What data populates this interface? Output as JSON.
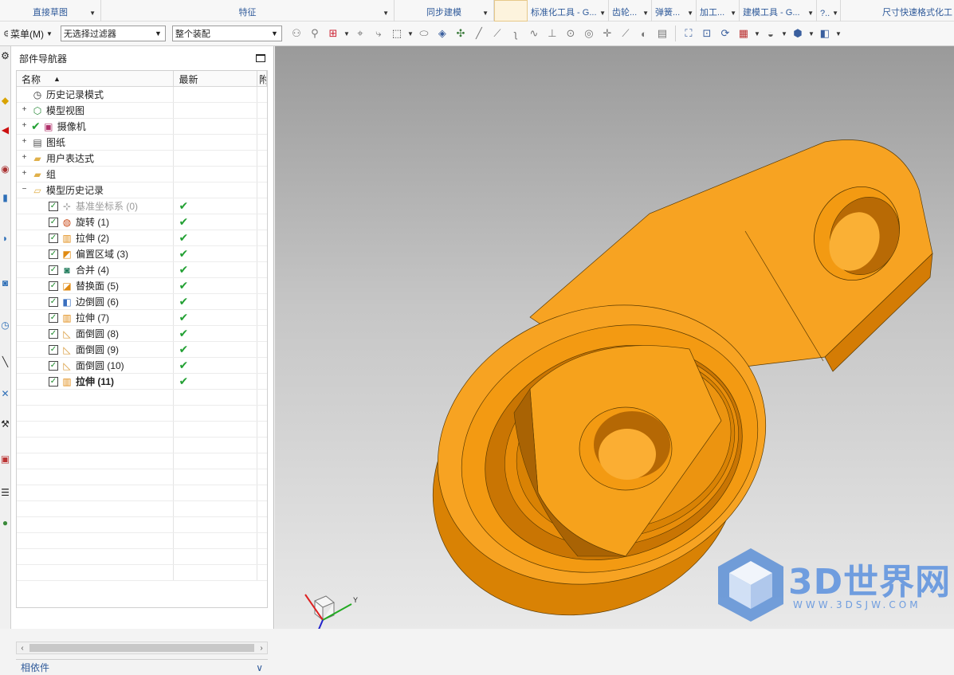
{
  "ribbon": {
    "groups": [
      {
        "label": "直接草图",
        "has_dropdown": true
      },
      {
        "label": "特征",
        "has_dropdown": true
      },
      {
        "label": "同步建模",
        "has_dropdown": true
      },
      {
        "label": ""
      },
      {
        "label": "标准化工具 - G...",
        "has_dropdown": true
      },
      {
        "label": "齿轮...",
        "has_dropdown": true
      },
      {
        "label": "弹簧...",
        "has_dropdown": true
      },
      {
        "label": "加工...",
        "has_dropdown": true
      },
      {
        "label": "建模工具 - G...",
        "has_dropdown": true
      },
      {
        "label": "?..",
        "has_dropdown": true
      },
      {
        "label": "尺寸快速格式化工"
      }
    ]
  },
  "toolbar": {
    "menu_label": "菜单(M)",
    "filter_value": "无选择过滤器",
    "assembly_value": "整个装配",
    "icons": [
      "snap-icon",
      "snap-point-icon",
      "select-icon",
      "selection-box-icon",
      "render-style-icon",
      "view-orient-icon",
      "point-icon",
      "line-icon",
      "curve-icon",
      "circle-icon",
      "rotate-icon",
      "layer-icon"
    ]
  },
  "navigator": {
    "title": "部件导航器",
    "columns": [
      "名称",
      "最新",
      "附"
    ],
    "rows": [
      {
        "label": "历史记录模式",
        "indent": 1,
        "expander": "",
        "checkbox": false,
        "icon": "clock-icon",
        "latest": ""
      },
      {
        "label": "模型视图",
        "indent": 1,
        "expander": "+",
        "checkbox": false,
        "icon": "model-view-icon",
        "latest": ""
      },
      {
        "label": "摄像机",
        "indent": 1,
        "expander": "+",
        "checkbox": false,
        "check_mark": "✔",
        "icon": "camera-icon",
        "latest": ""
      },
      {
        "label": "图纸",
        "indent": 1,
        "expander": "+",
        "checkbox": false,
        "icon": "drawing-icon",
        "latest": ""
      },
      {
        "label": "用户表达式",
        "indent": 1,
        "expander": "+",
        "checkbox": false,
        "icon": "folder-icon",
        "latest": ""
      },
      {
        "label": "组",
        "indent": 1,
        "expander": "+",
        "checkbox": false,
        "icon": "folder-icon",
        "latest": ""
      },
      {
        "label": "模型历史记录",
        "indent": 1,
        "expander": "−",
        "checkbox": false,
        "icon": "folder-open-icon",
        "latest": ""
      },
      {
        "label": "基准坐标系 (0)",
        "indent": 2,
        "checkbox": true,
        "icon": "datum-csys-icon",
        "latest": "✔",
        "style": "gray"
      },
      {
        "label": "旋转 (1)",
        "indent": 2,
        "checkbox": true,
        "icon": "revolve-icon",
        "latest": "✔"
      },
      {
        "label": "拉伸 (2)",
        "indent": 2,
        "checkbox": true,
        "icon": "extrude-icon",
        "latest": "✔"
      },
      {
        "label": "偏置区域 (3)",
        "indent": 2,
        "checkbox": true,
        "icon": "offset-region-icon",
        "latest": "✔"
      },
      {
        "label": "合并 (4)",
        "indent": 2,
        "checkbox": true,
        "icon": "unite-icon",
        "latest": "✔"
      },
      {
        "label": "替换面 (5)",
        "indent": 2,
        "checkbox": true,
        "icon": "replace-face-icon",
        "latest": "✔"
      },
      {
        "label": "边倒圆 (6)",
        "indent": 2,
        "checkbox": true,
        "icon": "edge-blend-icon",
        "latest": "✔"
      },
      {
        "label": "拉伸 (7)",
        "indent": 2,
        "checkbox": true,
        "icon": "extrude-icon",
        "latest": "✔"
      },
      {
        "label": "面倒圆 (8)",
        "indent": 2,
        "checkbox": true,
        "icon": "face-blend-icon",
        "latest": "✔"
      },
      {
        "label": "面倒圆 (9)",
        "indent": 2,
        "checkbox": true,
        "icon": "face-blend-icon",
        "latest": "✔"
      },
      {
        "label": "面倒圆 (10)",
        "indent": 2,
        "checkbox": true,
        "icon": "face-blend-icon",
        "latest": "✔"
      },
      {
        "label": "拉伸 (11)",
        "indent": 2,
        "checkbox": true,
        "icon": "extrude-icon",
        "latest": "✔",
        "style": "bold"
      }
    ],
    "dependency_label": "相依件"
  },
  "viewport": {
    "model_color": "#f39a12",
    "triad_labels": [
      "Y"
    ],
    "watermark_main": "3D世界网",
    "watermark_sub": "WWW.3DSJW.COM"
  },
  "colors": {
    "accent_blue": "#2f5a9a",
    "check_green": "#22a033",
    "model_orange": "#f39a12"
  }
}
